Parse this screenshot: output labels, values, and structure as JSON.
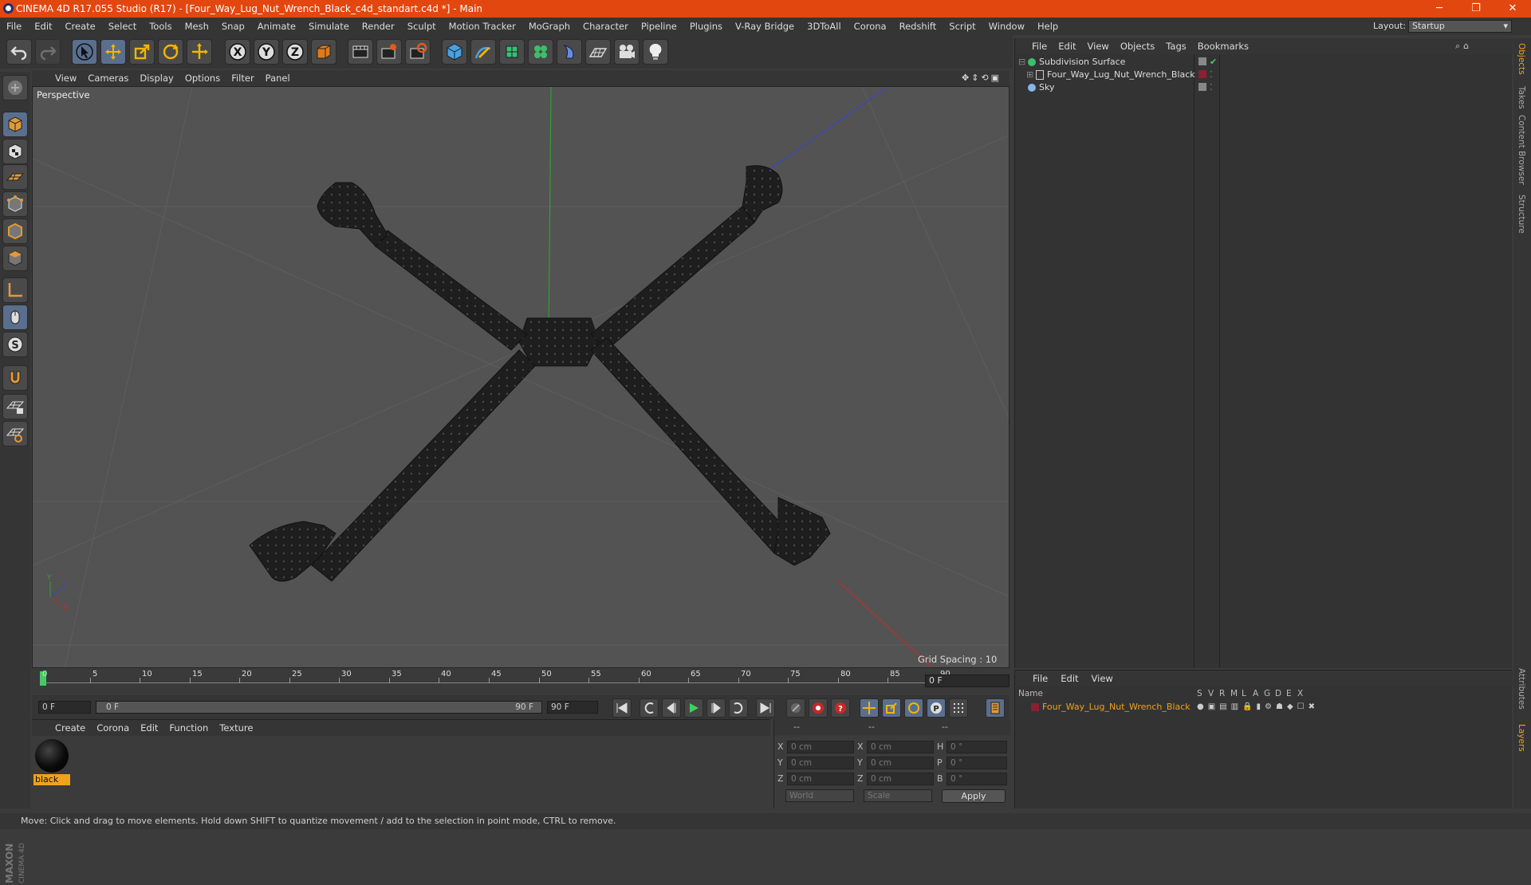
{
  "window": {
    "title": "CINEMA 4D R17.055 Studio (R17) - [Four_Way_Lug_Nut_Wrench_Black_c4d_standart.c4d *] - Main",
    "controls": [
      "─",
      "❐",
      "✕"
    ]
  },
  "menu": [
    "File",
    "Edit",
    "Create",
    "Select",
    "Tools",
    "Mesh",
    "Snap",
    "Animate",
    "Simulate",
    "Render",
    "Sculpt",
    "Motion Tracker",
    "MoGraph",
    "Character",
    "Pipeline",
    "Plugins",
    "V-Ray Bridge",
    "3DToAll",
    "Corona",
    "Redshift",
    "Script",
    "Window",
    "Help"
  ],
  "layout": {
    "label": "Layout:",
    "value": "Startup"
  },
  "toolbar": {
    "icons": [
      "undo-icon",
      "redo-icon",
      "select-arrow-icon",
      "move-icon",
      "scale-icon",
      "rotate-icon",
      "transform-icon",
      "x-axis-icon",
      "y-axis-icon",
      "z-axis-icon",
      "world-coords-icon",
      "render-view-icon",
      "render-picture-viewer-icon",
      "render-settings-icon",
      "cube-icon",
      "pen-icon",
      "subdivision-icon",
      "cloner-icon",
      "deformer-icon",
      "floor-icon",
      "camera-icon",
      "light-icon"
    ],
    "axis_labels": [
      "X",
      "Y",
      "Z"
    ]
  },
  "left_tools": [
    "make-editable-icon",
    "model-mode-icon",
    "texture-mode-icon",
    "workplane-icon",
    "points-mode-icon",
    "edges-mode-icon",
    "polygons-mode-icon",
    "axis-icon",
    "tweak-icon",
    "snap-s-icon",
    "magnet-icon",
    "lock-grid-icon",
    "layer-grid-icon"
  ],
  "viewport": {
    "menu": [
      "View",
      "Cameras",
      "Display",
      "Options",
      "Filter",
      "Panel"
    ],
    "label": "Perspective",
    "grid_spacing": "Grid Spacing : 10 cm",
    "axis_gizmo": [
      "Y",
      "Z",
      "X"
    ]
  },
  "timeline": {
    "ticks": [
      "0",
      "5",
      "10",
      "15",
      "20",
      "25",
      "30",
      "35",
      "40",
      "45",
      "50",
      "55",
      "60",
      "65",
      "70",
      "75",
      "80",
      "85",
      "90"
    ],
    "current_frame": "0 F",
    "start_field": "0 F",
    "range_start": "0 F",
    "range_end": "90 F",
    "end_field": "90 F",
    "playhead_fraction": 0
  },
  "material_manager": {
    "menu": [
      "Create",
      "Corona",
      "Edit",
      "Function",
      "Texture"
    ],
    "materials": [
      {
        "name": "black"
      }
    ]
  },
  "coordinates": {
    "headers": [
      "--",
      "--",
      "--"
    ],
    "rows": [
      {
        "a": "X",
        "pos": "0 cm",
        "b": "X",
        "size": "0 cm",
        "c": "H",
        "rot": "0 °"
      },
      {
        "a": "Y",
        "pos": "0 cm",
        "b": "Y",
        "size": "0 cm",
        "c": "P",
        "rot": "0 °"
      },
      {
        "a": "Z",
        "pos": "0 cm",
        "b": "Z",
        "size": "0 cm",
        "c": "B",
        "rot": "0 °"
      }
    ],
    "mode1": "World",
    "mode2": "Scale",
    "apply": "Apply"
  },
  "object_manager": {
    "menu": [
      "File",
      "Edit",
      "View",
      "Objects",
      "Tags",
      "Bookmarks"
    ],
    "objects": [
      {
        "name": "Subdivision Surface",
        "indent": 0
      },
      {
        "name": "Four_Way_Lug_Nut_Wrench_Black",
        "indent": 1
      },
      {
        "name": "Sky",
        "indent": 0
      }
    ]
  },
  "layer_manager": {
    "menu": [
      "File",
      "Edit",
      "View"
    ],
    "columns": [
      "Name",
      "S",
      "V",
      "R",
      "M",
      "L",
      "A",
      "G",
      "D",
      "E",
      "X"
    ],
    "layers": [
      {
        "name": "Four_Way_Lug_Nut_Wrench_Black",
        "color": "#8b2030"
      }
    ]
  },
  "side_tabs": [
    "Objects",
    "Takes",
    "Content Browser",
    "Structure"
  ],
  "side_tabs_bottom": [
    "Attributes",
    "Layers"
  ],
  "brand": {
    "text1": "MAXON",
    "text2": "CINEMA 4D"
  },
  "status": "Move: Click and drag to move elements. Hold down SHIFT to quantize movement / add to the selection in point mode, CTRL to remove.",
  "colors": {
    "title_bar": "#e2470f",
    "accent_orange": "#f0a21c",
    "selected_blue": "#5a6f8e"
  }
}
